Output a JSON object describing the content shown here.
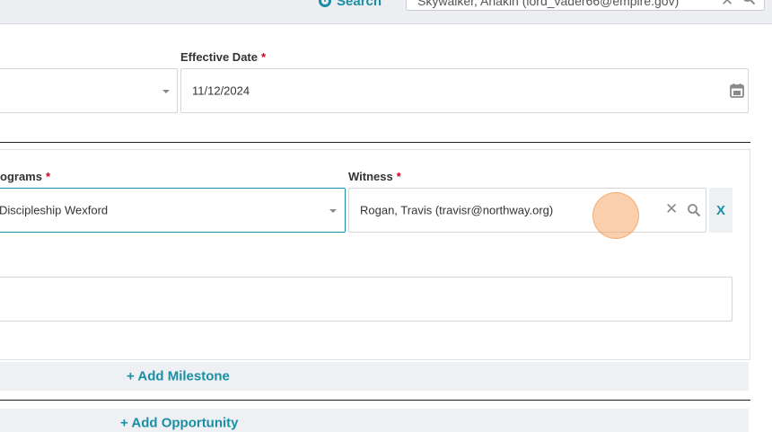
{
  "header": {
    "search_link_label": "Search",
    "search_value": "Skywalker, Anakin (lord_vader66@empire.gov)"
  },
  "form": {
    "effective_date": {
      "label": "Effective Date",
      "required_mark": "*",
      "value": "11/12/2024"
    }
  },
  "milestone": {
    "programs": {
      "label": "ograms",
      "required_mark": "*",
      "value": "Discipleship Wexford"
    },
    "witness": {
      "label": "Witness",
      "required_mark": "*",
      "value": "Rogan, Travis (travisr@northway.org)"
    },
    "remove_label": "X",
    "notes_value": ""
  },
  "actions": {
    "add_milestone": "+ Add Milestone",
    "add_opportunity": "+ Add Opportunity"
  },
  "colors": {
    "accent": "#1a8fa3",
    "required": "#d0021b",
    "bar_bg": "#eef0f3",
    "cursor_highlight": "#f7a866"
  },
  "icons": {
    "search_link": "search-circle-icon",
    "clear": "close-icon",
    "magnifier": "search-icon",
    "calendar": "calendar-icon",
    "dropdown": "chevron-down-icon"
  }
}
